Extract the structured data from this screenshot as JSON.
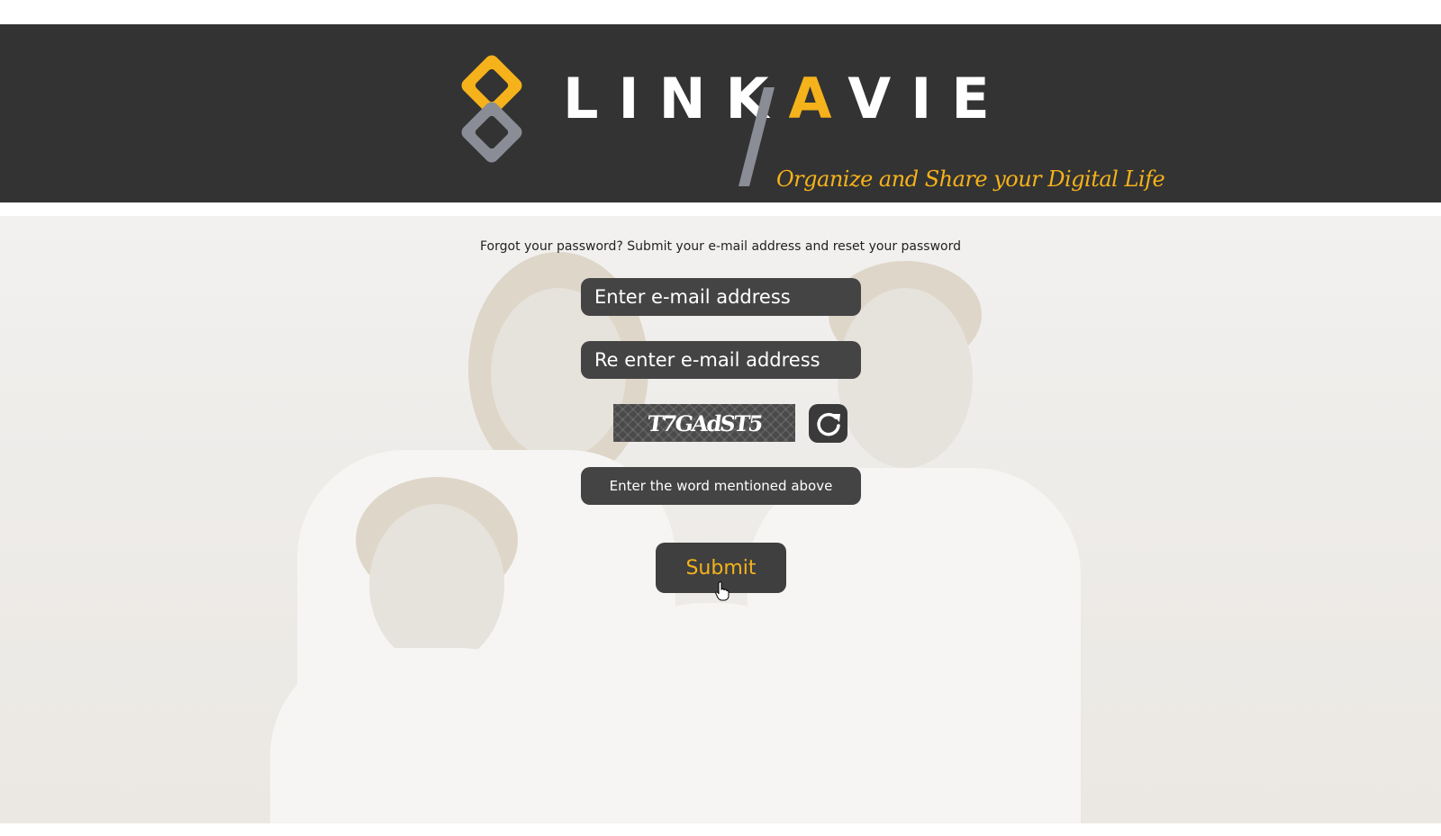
{
  "header": {
    "logo_word": {
      "pre": "LINK",
      "accent": "A",
      "post": "VIE"
    },
    "tagline": "Organize and Share your Digital Life"
  },
  "form": {
    "instruction": "Forgot your password? Submit your e-mail address and reset your password",
    "email_placeholder": "Enter e-mail address",
    "reemail_placeholder": "Re enter e-mail address",
    "captcha_text": "T7GAdST5",
    "captcha_placeholder": "Enter the word mentioned above",
    "submit_label": "Submit"
  },
  "colors": {
    "header_bg": "#333333",
    "accent": "#f5b21b",
    "field_bg": "#444444",
    "logo_grey": "#8a8d95"
  },
  "icons": {
    "refresh": "refresh-icon",
    "logo": "linkavie-logo-mark",
    "cursor": "hand-pointer-cursor"
  }
}
